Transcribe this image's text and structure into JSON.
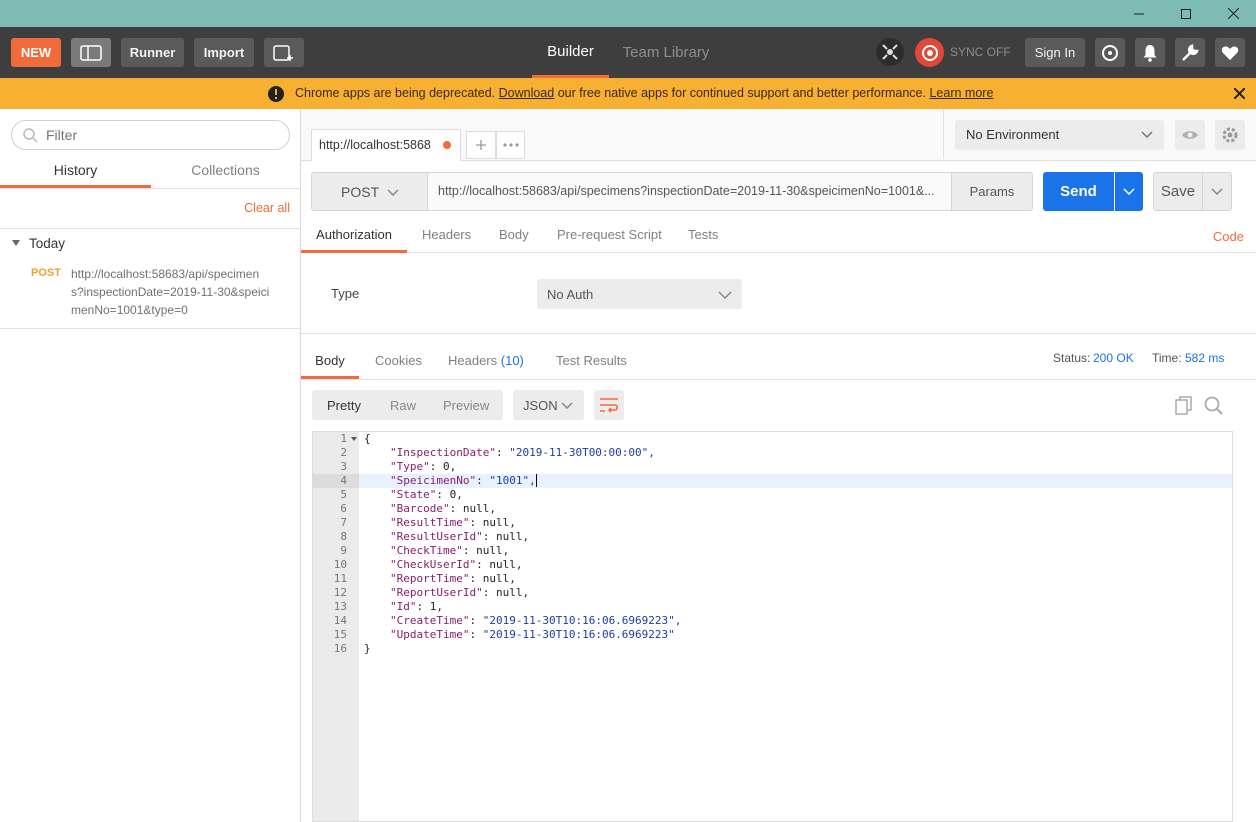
{
  "toolbar": {
    "new_label": "NEW",
    "runner_label": "Runner",
    "import_label": "Import",
    "tab_builder": "Builder",
    "tab_team": "Team Library",
    "sync_label": "SYNC OFF",
    "signin_label": "Sign In"
  },
  "banner": {
    "text_pre": "Chrome apps are being deprecated.",
    "download": "Download",
    "text_mid": "our free native apps for continued support and better performance.",
    "learn_more": "Learn more"
  },
  "sidebar": {
    "filter_placeholder": "Filter",
    "tab_history": "History",
    "tab_collections": "Collections",
    "clear_all": "Clear all",
    "group_today": "Today",
    "history": [
      {
        "method": "POST",
        "url_lines": [
          "http://localhost:58683/api/specimen",
          "s?inspectionDate=2019-11-30&speici",
          "menNo=1001&type=0"
        ]
      }
    ]
  },
  "request": {
    "tab_url": "http://localhost:5868",
    "method": "POST",
    "url": "http://localhost:58683/api/specimens?inspectionDate=2019-11-30&speicimenNo=1001&...",
    "params": "Params",
    "send": "Send",
    "save": "Save",
    "environment": "No Environment",
    "tabs": [
      "Authorization",
      "Headers",
      "Body",
      "Pre-request Script",
      "Tests"
    ],
    "code_link": "Code",
    "auth_type_label": "Type",
    "auth_type_value": "No Auth"
  },
  "response": {
    "tabs": [
      "Body",
      "Cookies",
      "Headers",
      "(10)",
      "Test Results"
    ],
    "status_label": "Status:",
    "status_value": "200 OK",
    "time_label": "Time:",
    "time_value": "582 ms",
    "view_modes": [
      "Pretty",
      "Raw",
      "Preview"
    ],
    "format": "JSON",
    "lines": [
      {
        "n": "1",
        "k": "",
        "v": "{",
        "t": "p"
      },
      {
        "n": "2",
        "k": "\"InspectionDate\"",
        "v": "\"2019-11-30T00:00:00\",",
        "t": "s"
      },
      {
        "n": "3",
        "k": "\"Type\"",
        "v": "0,",
        "t": "p"
      },
      {
        "n": "4",
        "k": "\"SpeicimenNo\"",
        "v": "\"1001\",",
        "t": "s"
      },
      {
        "n": "5",
        "k": "\"State\"",
        "v": "0,",
        "t": "p"
      },
      {
        "n": "6",
        "k": "\"Barcode\"",
        "v": "null,",
        "t": "p"
      },
      {
        "n": "7",
        "k": "\"ResultTime\"",
        "v": "null,",
        "t": "p"
      },
      {
        "n": "8",
        "k": "\"ResultUserId\"",
        "v": "null,",
        "t": "p"
      },
      {
        "n": "9",
        "k": "\"CheckTime\"",
        "v": "null,",
        "t": "p"
      },
      {
        "n": "10",
        "k": "\"CheckUserId\"",
        "v": "null,",
        "t": "p"
      },
      {
        "n": "11",
        "k": "\"ReportTime\"",
        "v": "null,",
        "t": "p"
      },
      {
        "n": "12",
        "k": "\"ReportUserId\"",
        "v": "null,",
        "t": "p"
      },
      {
        "n": "13",
        "k": "\"Id\"",
        "v": "1,",
        "t": "p"
      },
      {
        "n": "14",
        "k": "\"CreateTime\"",
        "v": "\"2019-11-30T10:16:06.6969223\",",
        "t": "s"
      },
      {
        "n": "15",
        "k": "\"UpdateTime\"",
        "v": "\"2019-11-30T10:16:06.6969223\"",
        "t": "s"
      },
      {
        "n": "16",
        "k": "",
        "v": "}",
        "t": "p"
      }
    ]
  },
  "colors": {
    "accent": "#f26b3a",
    "send_blue": "#1a73e8",
    "banner": "#f8b033",
    "titlebar": "#7fbbb5",
    "toolbar": "#3e3e3e"
  }
}
